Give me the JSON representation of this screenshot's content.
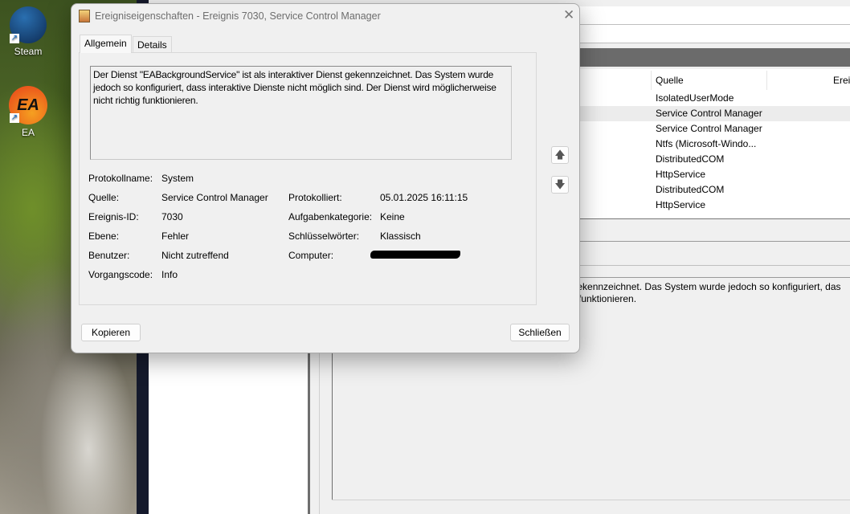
{
  "desktop": {
    "icons": [
      {
        "label": "Steam",
        "icon": "steam-icon"
      },
      {
        "label": "EA",
        "icon": "ea-icon"
      }
    ]
  },
  "event_viewer": {
    "columns": [
      "Quelle",
      "Ereig"
    ],
    "rows": [
      "IsolatedUserMode",
      "Service Control Manager",
      "Service Control Manager",
      "Ntfs (Microsoft-Windo...",
      "DistributedCOM",
      "HttpService",
      "DistributedCOM",
      "HttpService"
    ],
    "preview_line1": "t gekennzeichnet. Das System wurde jedoch so konfiguriert, das",
    "preview_line2": "funktionieren."
  },
  "dialog": {
    "title": "Ereigniseigenschaften - Ereignis 7030, Service Control Manager",
    "tabs": [
      "Allgemein",
      "Details"
    ],
    "message": "Der Dienst \"EABackgroundService\" ist als interaktiver Dienst gekennzeichnet. Das System wurde jedoch so konfiguriert, dass interaktive Dienste nicht möglich sind. Der Dienst wird möglicherweise nicht richtig funktionieren.",
    "fields": {
      "log_name_label": "Protokollname:",
      "log_name": "System",
      "source_label": "Quelle:",
      "source": "Service Control Manager",
      "event_id_label": "Ereignis-ID:",
      "event_id": "7030",
      "level_label": "Ebene:",
      "level": "Fehler",
      "user_label": "Benutzer:",
      "user": "Nicht zutreffend",
      "opcode_label": "Vorgangscode:",
      "opcode": "Info",
      "logged_label": "Protokolliert:",
      "logged": "05.01.2025 16:11:15",
      "task_category_label": "Aufgabenkategorie:",
      "task_category": "Keine",
      "keywords_label": "Schlüsselwörter:",
      "keywords": "Klassisch",
      "computer_label": "Computer:"
    },
    "copy_label": "Kopieren",
    "close_label": "Schließen"
  }
}
